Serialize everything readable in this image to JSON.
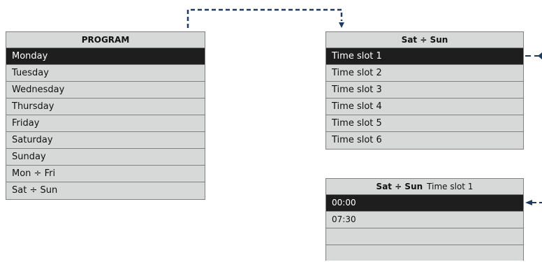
{
  "program_menu": {
    "title": "PROGRAM",
    "items": [
      {
        "label": "Monday",
        "selected": true
      },
      {
        "label": "Tuesday",
        "selected": false
      },
      {
        "label": "Wednesday",
        "selected": false
      },
      {
        "label": "Thursday",
        "selected": false
      },
      {
        "label": "Friday",
        "selected": false
      },
      {
        "label": "Saturday",
        "selected": false
      },
      {
        "label": "Sunday",
        "selected": false
      },
      {
        "label": "Mon ÷ Fri",
        "selected": false
      },
      {
        "label": "Sat ÷ Sun",
        "selected": false
      }
    ]
  },
  "satsun_menu": {
    "title": "Sat ÷ Sun",
    "items": [
      {
        "label": "Time slot 1",
        "selected": true
      },
      {
        "label": "Time slot 2",
        "selected": false
      },
      {
        "label": "Time slot 3",
        "selected": false
      },
      {
        "label": "Time slot 4",
        "selected": false
      },
      {
        "label": "Time slot 5",
        "selected": false
      },
      {
        "label": "Time slot 6",
        "selected": false
      }
    ]
  },
  "timeslot_menu": {
    "title_bold": "Sat ÷ Sun",
    "title_normal": "Time slot 1",
    "items": [
      {
        "label": "00:00",
        "selected": true
      },
      {
        "label": "07:30",
        "selected": false
      },
      {
        "label": "",
        "selected": false
      },
      {
        "label": "",
        "selected": false
      }
    ]
  },
  "colors": {
    "menu_bg": "#d7d8d8",
    "selected_bg": "#1e1e1e",
    "selected_fg": "#ffffff",
    "connector": "#1f3a5f",
    "border": "#808080"
  },
  "icons": [
    "dashed-connector-arrow",
    "right-pointer-arrow"
  ]
}
